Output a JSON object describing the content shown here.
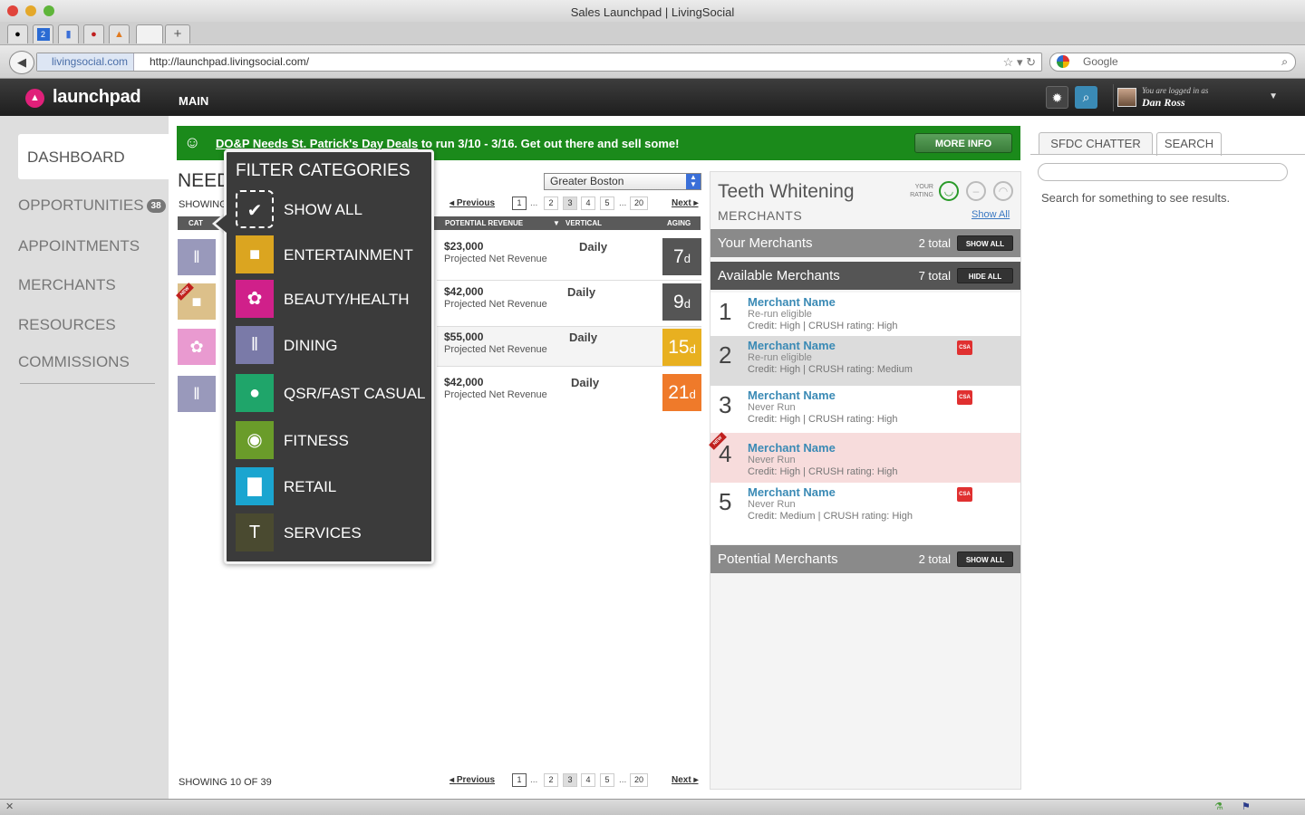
{
  "window": {
    "title": "Sales Launchpad | LivingSocial"
  },
  "browser": {
    "tabs": [
      "2"
    ],
    "url_host": "livingsocial.com",
    "url": "http://launchpad.livingsocial.com/",
    "search_placeholder": "Google",
    "new_tab": "+"
  },
  "app": {
    "logo": "launchpad",
    "nav": "MAIN",
    "user_prefix": "You are logged in as",
    "user_name": "Dan Ross"
  },
  "sidebar": {
    "items": [
      {
        "label": "DASHBOARD"
      },
      {
        "label": "OPPORTUNITIES",
        "badge": "38"
      },
      {
        "label": "APPOINTMENTS"
      },
      {
        "label": "MERCHANTS"
      },
      {
        "label": "RESOURCES"
      },
      {
        "label": "COMMISSIONS"
      }
    ]
  },
  "banner": {
    "link": "DO&P Needs St. Patrick's Day Deals",
    "rest": " to run 3/10 - 3/16. Get out there and sell some!",
    "button": "MORE INFO"
  },
  "opps": {
    "heading": "NEED",
    "showing_partial": "SHOWING",
    "city": "Greater Boston",
    "pager": {
      "prev": "Previous",
      "next": "Next",
      "pages": [
        "1",
        "2",
        "3",
        "4",
        "5",
        "20"
      ],
      "dots": "..."
    },
    "columns": {
      "cat": "CAT",
      "revenue": "POTENTIAL REVENUE",
      "vertical": "VERTICAL",
      "aging": "AGING"
    },
    "rows": [
      {
        "revenue": "$23,000",
        "sub": "Projected Net Revenue",
        "freq": "Daily",
        "age": "7",
        "unit": "d",
        "color": "#555555",
        "cat_color": "#9999bb"
      },
      {
        "revenue": "$42,000",
        "sub": "Projected Net Revenue",
        "freq": "Daily",
        "age": "9",
        "unit": "d",
        "color": "#555555",
        "cat_color": "#dcc08a"
      },
      {
        "revenue": "$55,000",
        "sub": "Projected Net Revenue",
        "freq": "Daily",
        "age": "15",
        "unit": "d",
        "color": "#e8b020",
        "cat_color": "#e99ad0"
      },
      {
        "revenue": "$42,000",
        "sub": "Projected Net Revenue",
        "freq": "Daily",
        "age": "21",
        "unit": "d",
        "color": "#ef7a2a",
        "cat_color": "#9999bb"
      }
    ],
    "new_label": "NEW",
    "bottom_showing": "SHOWING 10 OF 39"
  },
  "filter": {
    "title": "FILTER CATEGORIES",
    "items": [
      {
        "label": "SHOW ALL",
        "icon": "check-icon",
        "color": "#3b3b3b"
      },
      {
        "label": "ENTERTAINMENT",
        "icon": "camera-icon",
        "color": "#dba520"
      },
      {
        "label": "BEAUTY/HEALTH",
        "icon": "flower-icon",
        "color": "#d0208a"
      },
      {
        "label": "DINING",
        "icon": "fork-knife-icon",
        "color": "#7a7aa8"
      },
      {
        "label": "QSR/FAST CASUAL",
        "icon": "burger-icon",
        "color": "#1fa56a"
      },
      {
        "label": "FITNESS",
        "icon": "ball-icon",
        "color": "#6a9c2a"
      },
      {
        "label": "RETAIL",
        "icon": "bag-icon",
        "color": "#1aa5d0"
      },
      {
        "label": "SERVICES",
        "icon": "hammer-icon",
        "color": "#4a4a30"
      }
    ]
  },
  "merchants": {
    "title": "Teeth Whitening",
    "subtitle": "MERCHANTS",
    "your_rating": "YOUR RATING",
    "show_all_link": "Show All",
    "your": {
      "label": "Your Merchants",
      "total": "2 total",
      "btn": "SHOW ALL"
    },
    "available": {
      "label": "Available Merchants",
      "total": "7 total",
      "btn": "HIDE ALL"
    },
    "potential": {
      "label": "Potential Merchants",
      "total": "2 total",
      "btn": "SHOW ALL"
    },
    "csa": "CSA",
    "list": [
      {
        "num": "1",
        "name": "Merchant Name",
        "status": "Re-run eligible",
        "credit": "Credit: High | CRUSH rating: High"
      },
      {
        "num": "2",
        "name": "Merchant Name",
        "status": "Re-run eligible",
        "credit": "Credit: High | CRUSH rating: Medium"
      },
      {
        "num": "3",
        "name": "Merchant Name",
        "status": "Never Run",
        "credit": "Credit: High | CRUSH rating: High"
      },
      {
        "num": "4",
        "name": "Merchant Name",
        "status": "Never Run",
        "credit": "Credit: High | CRUSH rating: High"
      },
      {
        "num": "5",
        "name": "Merchant Name",
        "status": "Never Run",
        "credit": "Credit: Medium | CRUSH rating: High"
      }
    ]
  },
  "side": {
    "tab1": "SFDC CHATTER",
    "tab2": "SEARCH",
    "hint": "Search for something to see results."
  },
  "colors": {
    "banner": "#1b8a1b",
    "link": "#3a8ab5",
    "brand": "#e0207a"
  }
}
